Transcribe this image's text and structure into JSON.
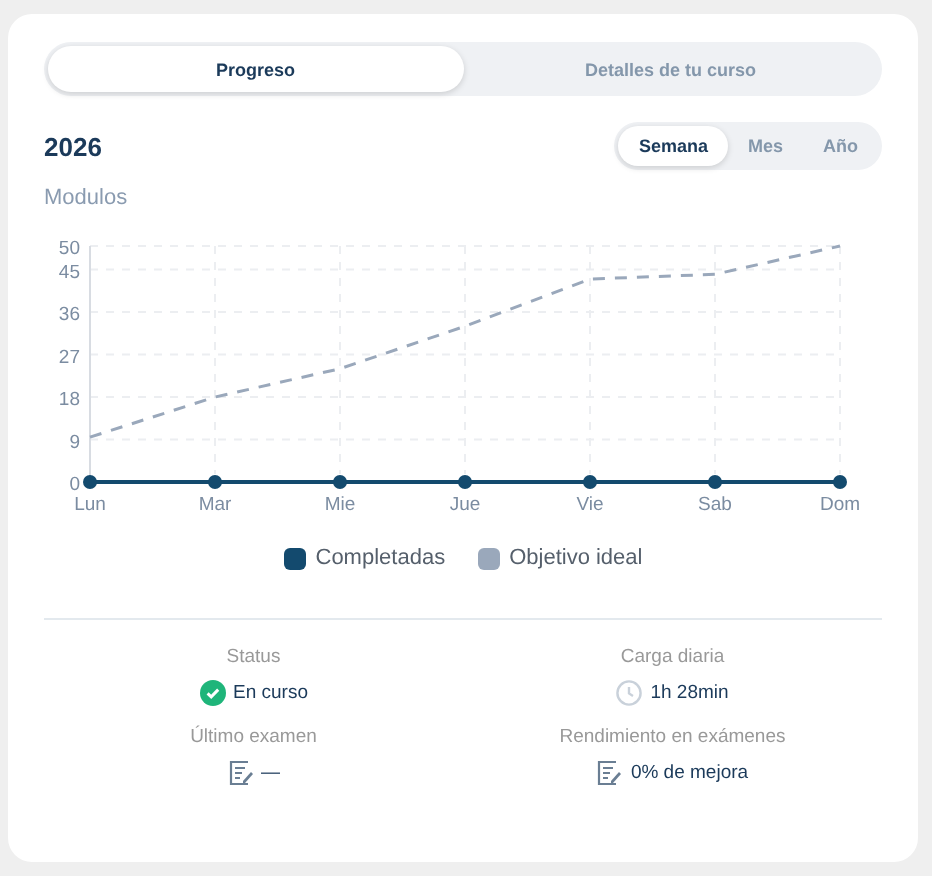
{
  "tabs": [
    {
      "label": "Progreso",
      "selected": true
    },
    {
      "label": "Detalles de tu curso",
      "selected": false
    }
  ],
  "year": "2026",
  "periods": [
    {
      "label": "Semana",
      "selected": true
    },
    {
      "label": "Mes",
      "selected": false
    },
    {
      "label": "Año",
      "selected": false
    }
  ],
  "chart": {
    "chart_data": {
      "type": "line",
      "ylabel": "Modulos",
      "categories": [
        "Lun",
        "Mar",
        "Mie",
        "Jue",
        "Vie",
        "Sab",
        "Dom"
      ],
      "ylim": [
        0,
        50
      ],
      "yticks": [
        0,
        9,
        18,
        27,
        36,
        45,
        50
      ],
      "grid": true,
      "series": [
        {
          "name": "Completadas",
          "color": "#134a6e",
          "values": [
            0,
            0,
            0,
            0,
            0,
            0,
            0
          ],
          "line_style": "solid",
          "marker": "circle"
        },
        {
          "name": "Objetivo ideal",
          "color": "#9aa8bb",
          "values": [
            9.5,
            18,
            24,
            33,
            43,
            44,
            50
          ],
          "line_style": "dashed"
        }
      ]
    }
  },
  "stats": [
    {
      "label": "Status",
      "value": "En curso",
      "kind": "status"
    },
    {
      "label": "Carga diaria",
      "value": "1h 28min",
      "kind": "time"
    },
    {
      "label": "Último examen",
      "value": "—",
      "kind": "exam"
    },
    {
      "label": "Rendimiento en exámenes",
      "value": "0% de mejora",
      "kind": "exam"
    }
  ]
}
